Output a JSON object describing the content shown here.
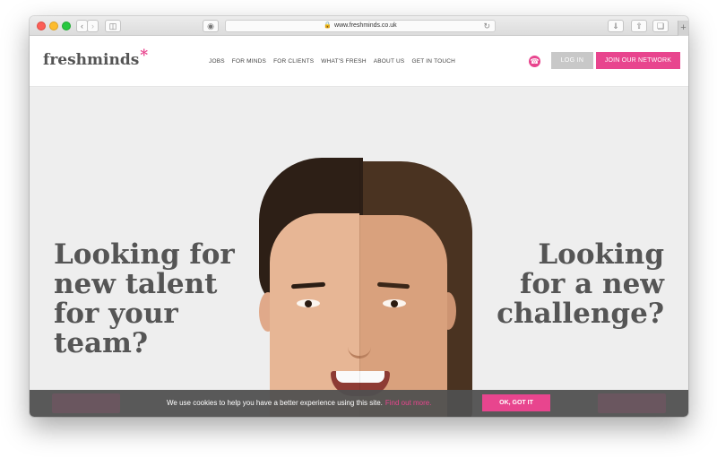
{
  "browser": {
    "url": "www.freshminds.co.uk"
  },
  "site": {
    "logo_text": "freshminds",
    "logo_mark": "*",
    "nav": [
      "JOBS",
      "FOR MINDS",
      "FOR CLIENTS",
      "WHAT'S FRESH",
      "ABOUT US",
      "GET IN TOUCH"
    ],
    "login_label": "LOG IN",
    "join_label": "JOIN OUR NETWORK"
  },
  "hero": {
    "left_lines": [
      "Looking for",
      "new talent",
      "for your",
      "team?"
    ],
    "right_lines": [
      "Looking",
      "for a new",
      "challenge?"
    ]
  },
  "cookie": {
    "text": "We use cookies to help you have a better experience using this site.",
    "link_text": "Find out more.",
    "button_label": "OK, GOT IT"
  },
  "colors": {
    "brand_pink": "#e8458e",
    "text_gray": "#555555",
    "login_gray": "#c8c8c8"
  }
}
